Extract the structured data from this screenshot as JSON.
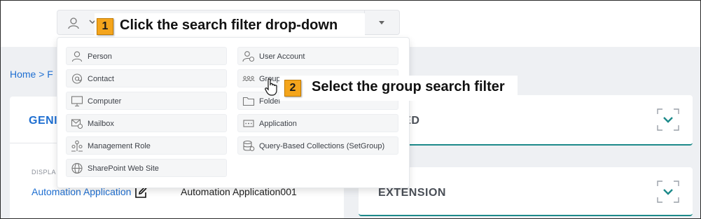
{
  "search_filter": {
    "current_icon": "person-icon",
    "toggle_icon": "chevron-down-icon",
    "dropdown_icon": "caret-down-icon"
  },
  "callouts": [
    {
      "number": "1",
      "text": "Click the search filter drop-down"
    },
    {
      "number": "2",
      "text": "Select the group search filter"
    }
  ],
  "breadcrumb": {
    "text": "Home > F"
  },
  "filter_menu": {
    "left_column": [
      {
        "label": "Person",
        "icon": "person-icon"
      },
      {
        "label": "Contact",
        "icon": "at-sign-icon"
      },
      {
        "label": "Computer",
        "icon": "computer-icon"
      },
      {
        "label": "Mailbox",
        "icon": "mailbox-icon"
      },
      {
        "label": "Management Role",
        "icon": "management-role-icon"
      },
      {
        "label": "SharePoint Web Site",
        "icon": "globe-icon"
      }
    ],
    "right_column": [
      {
        "label": "User Account",
        "icon": "user-account-icon"
      },
      {
        "label": "Group",
        "icon": "group-icon"
      },
      {
        "label": "Folder",
        "icon": "folder-icon"
      },
      {
        "label": "Application",
        "icon": "application-icon"
      },
      {
        "label": "Query-Based Collections (SetGroup)",
        "icon": "database-icon"
      }
    ]
  },
  "general_card": {
    "title": "GENI",
    "field_label": "DISPLA",
    "attribute_name": "Automation Application",
    "attribute_value": "Automation Application001"
  },
  "advanced_card": {
    "title": "ANCED"
  },
  "extension_card": {
    "title": "EXTENSION"
  },
  "colors": {
    "accent_blue": "#1f6fd1",
    "teal": "#1d8a8a",
    "callout_orange": "#f4a51c"
  }
}
